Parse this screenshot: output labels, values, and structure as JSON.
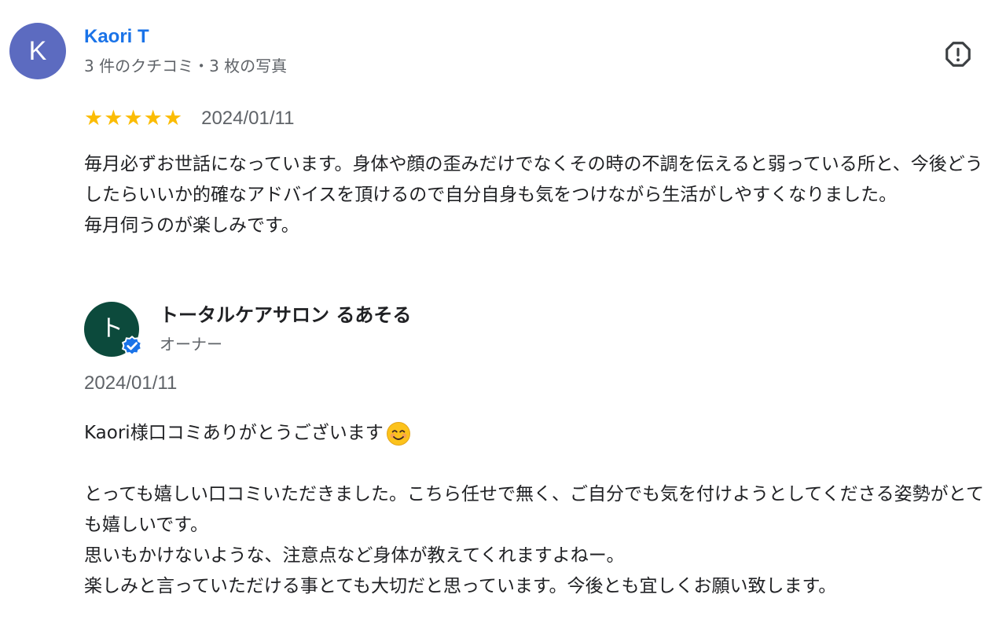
{
  "review": {
    "avatar_letter": "K",
    "reviewer_name": "Kaori T",
    "reviewer_meta": "3 件のクチコミ・3 枚の写真",
    "rating": 5,
    "stars": [
      "★",
      "★",
      "★",
      "★",
      "★"
    ],
    "date": "2024/01/11",
    "text_lines": [
      "毎月必ずお世話になっています。身体や顔の歪みだけでなくその時の不調を伝えると弱っている所と、今後どうしたらいいか的確なアドバイスを頂けるので自分自身も気をつけながら生活がしやすくなりました。",
      "毎月伺うのが楽しみです。"
    ]
  },
  "owner_response": {
    "avatar_letter": "ト",
    "name": "トータルケアサロン るあそる",
    "label": "オーナー",
    "date": "2024/01/11",
    "first_line": "Kaori様口コミありがとうございます",
    "paragraph_lines": [
      "とっても嬉しい口コミいただきました。こちら任せで無く、ご自分でも気を付けようとしてくださる姿勢がとても嬉しいです。",
      "思いもかけないような、注意点など身体が教えてくれますよねー。",
      "楽しみと言っていただける事とても大切だと思っています。今後とも宜しくお願い致します。"
    ]
  },
  "colors": {
    "reviewer_avatar": "#5c6bc0",
    "reviewer_name": "#1a73e8",
    "star": "#fbbc04",
    "owner_avatar": "#0c4a3c",
    "verified": "#1a73e8"
  },
  "icons": {
    "report": "report-flag-icon",
    "verified": "verified-check-icon",
    "smile": "smiling-face-emoji"
  }
}
